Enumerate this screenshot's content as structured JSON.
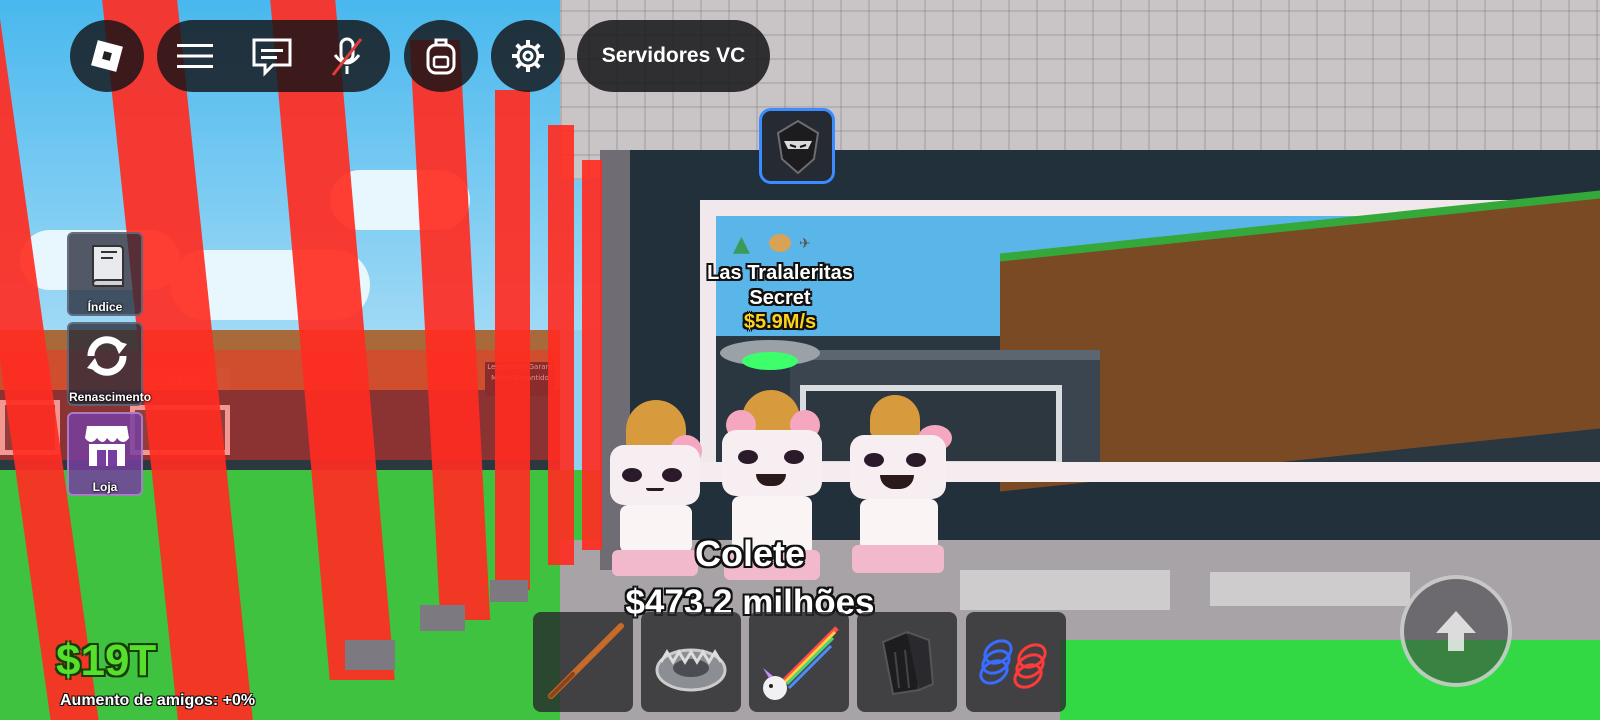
{
  "top_bar": {
    "servers_label": "Servidores VC"
  },
  "side_menu": {
    "items": [
      {
        "label": "Índice",
        "icon": "book-icon"
      },
      {
        "label": "Renascimento",
        "icon": "refresh-icon"
      },
      {
        "label": "Loja",
        "icon": "shop-icon"
      }
    ]
  },
  "pet_display": {
    "name": "Las Tralaleritas",
    "rarity": "Secret",
    "rate": "$5.9M/s"
  },
  "collect": {
    "label": "Colete",
    "amount": "$473.2 milhões"
  },
  "player_stats": {
    "money": "$19T",
    "friend_boost": "Aumento de amigos: +0%"
  },
  "world_signs": {
    "left_sign": "vazia",
    "shop_sign_line1": "Legendário Garant",
    "shop_sign_line2": "Mítico Garantido"
  },
  "hotbar": {
    "slots": [
      {
        "item": "bat-icon"
      },
      {
        "item": "bear-trap-icon"
      },
      {
        "item": "unicorn-sword-icon"
      },
      {
        "item": "gloves-icon"
      },
      {
        "item": "coil-icon"
      }
    ]
  },
  "colors": {
    "money_green": "#55e02c",
    "rate_yellow": "#ffd21a",
    "accent_blue": "#3a8cff"
  }
}
